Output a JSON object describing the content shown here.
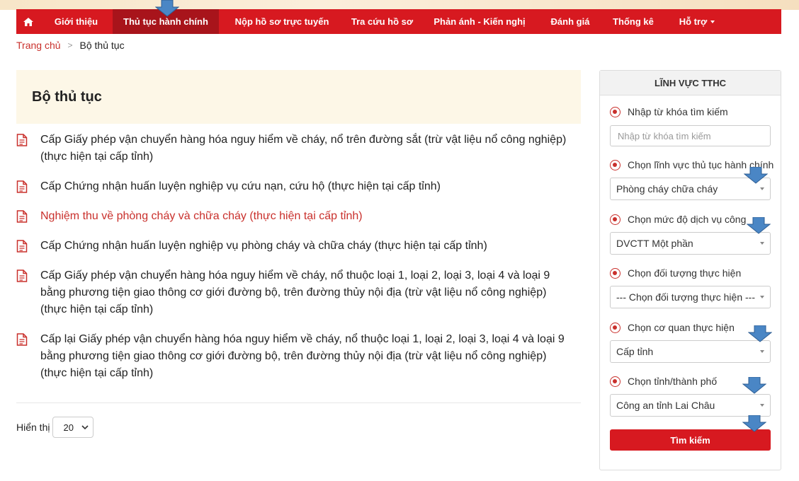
{
  "nav": {
    "items": [
      {
        "label": "Giới thiệu"
      },
      {
        "label": "Thủ tục hành chính"
      },
      {
        "label": "Nộp hồ sơ trực tuyến"
      },
      {
        "label": "Tra cứu hồ sơ"
      },
      {
        "label": "Phản ánh - Kiến nghị"
      },
      {
        "label": "Đánh giá"
      },
      {
        "label": "Thống kê"
      },
      {
        "label": "Hỗ trợ"
      }
    ]
  },
  "breadcrumb": {
    "home": "Trang chủ",
    "separator": ">",
    "current": "Bộ thủ tục"
  },
  "main": {
    "title": "Bộ thủ tục",
    "procedures": [
      {
        "text": "Cấp Giấy phép vận chuyển hàng hóa nguy hiểm về cháy, nổ trên đường sắt (trừ vật liệu nổ công nghiệp) (thực hiện tại cấp tỉnh)"
      },
      {
        "text": "Cấp Chứng nhận huấn luyện nghiệp vụ cứu nạn, cứu hộ (thực hiện tại cấp tỉnh)"
      },
      {
        "text": "Nghiệm thu về phòng cháy và chữa cháy (thực hiện tại cấp tỉnh)"
      },
      {
        "text": "Cấp Chứng nhận huấn luyện nghiệp vụ phòng cháy và chữa cháy (thực hiện tại cấp tỉnh)"
      },
      {
        "text": "Cấp Giấy phép vận chuyển hàng hóa nguy hiểm về cháy, nổ thuộc loại 1, loại 2, loại 3, loại 4 và loại 9 bằng phương tiện giao thông cơ giới đường bộ, trên đường thủy nội địa (trừ vật liệu nổ công nghiệp) (thực hiện tại cấp tỉnh)"
      },
      {
        "text": "Cấp lại Giấy phép vận chuyển hàng hóa nguy hiểm về cháy, nổ thuộc loại 1, loại 2, loại 3, loại 4 và loại 9 bằng phương tiện giao thông cơ giới đường bộ, trên đường thủy nội địa (trừ vật liệu nổ công nghiệp) (thực hiện tại cấp tỉnh)"
      }
    ],
    "page_size_label": "Hiển thị",
    "page_size_value": "20"
  },
  "sidebar": {
    "title": "LĨNH VỰC TTHC",
    "keyword_label": "Nhập từ khóa tìm kiếm",
    "keyword_placeholder": "Nhập từ khóa tìm kiếm",
    "field_label": "Chọn lĩnh vực thủ tục hành chính",
    "field_value": "Phòng cháy chữa cháy",
    "level_label": "Chọn mức độ dịch vụ công",
    "level_value": "DVCTT Một phần",
    "subject_label": "Chọn đối tượng thực hiện",
    "subject_value": "--- Chọn đối tượng thực hiện ---",
    "agency_label": "Chọn cơ quan thực hiện",
    "agency_value": "Cấp tỉnh",
    "province_label": "Chọn tỉnh/thành phố",
    "province_value": "Công an tỉnh Lai Châu",
    "search_label": "Tìm kiếm"
  },
  "colors": {
    "primary_red": "#d71920",
    "active_red": "#a8141b",
    "title_bg": "#fdf7e7",
    "arrow_blue": "#4a86c5"
  }
}
